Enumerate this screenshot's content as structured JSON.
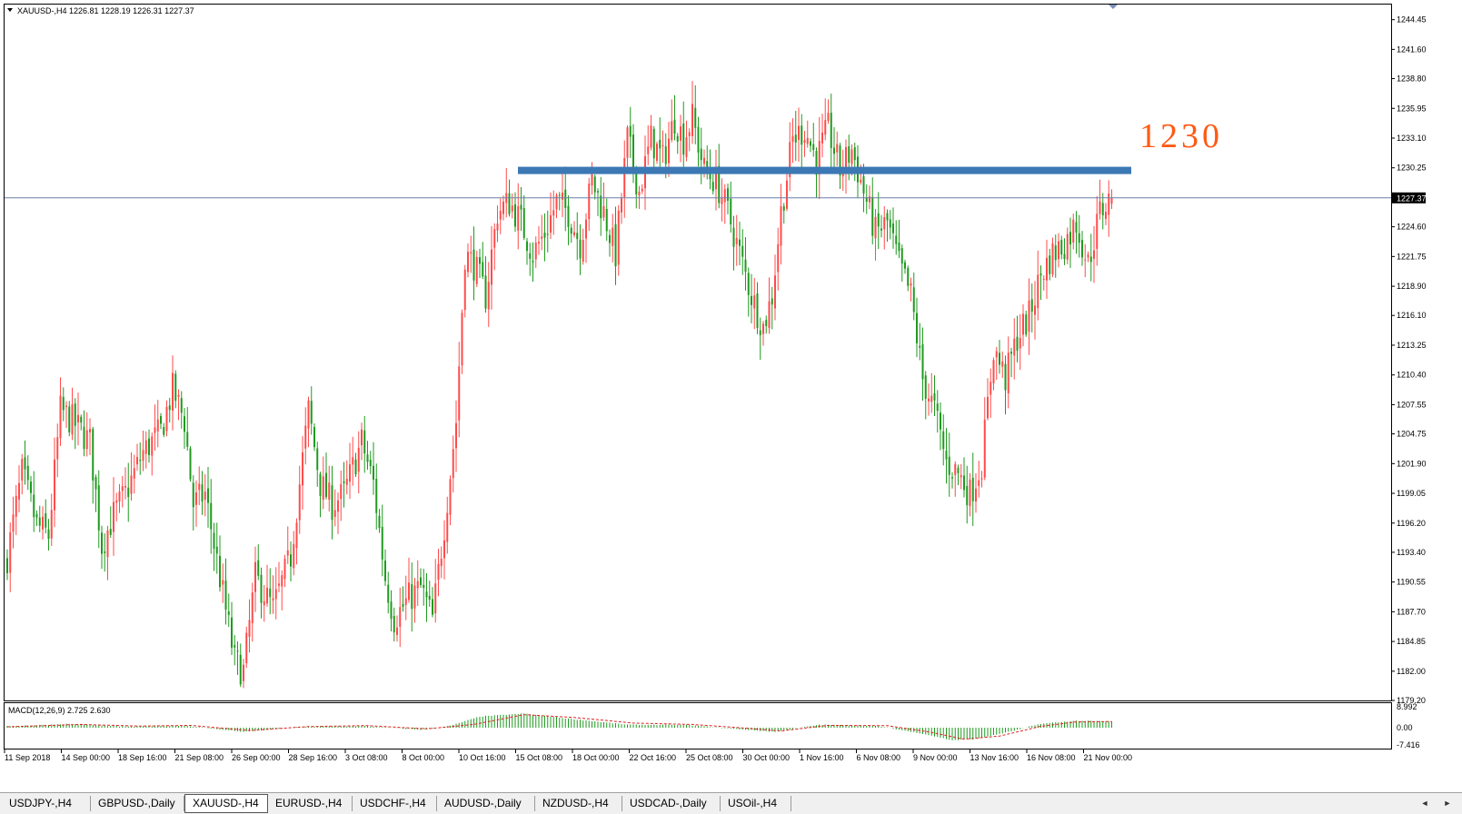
{
  "header": {
    "symbol_line": "XAUUSD-,H4  1226.81 1228.19 1226.31 1227.37"
  },
  "annotation": {
    "level_text": "1230"
  },
  "price_axis": {
    "labels": [
      "1244.45",
      "1241.60",
      "1238.80",
      "1235.95",
      "1233.10",
      "1230.25",
      "1224.60",
      "1221.75",
      "1218.90",
      "1216.10",
      "1213.25",
      "1210.40",
      "1207.55",
      "1204.75",
      "1201.90",
      "1199.05",
      "1196.20",
      "1193.40",
      "1190.55",
      "1187.70",
      "1184.85",
      "1182.00",
      "1179.20"
    ],
    "current_price": "1227.37"
  },
  "macd": {
    "title": "MACD(12,26,9) 2.725 2.630",
    "axis_labels": [
      "8.992",
      "0.00",
      "-7.416"
    ]
  },
  "time_axis": {
    "labels": [
      "11 Sep 2018",
      "14 Sep 00:00",
      "18 Sep 16:00",
      "21 Sep 08:00",
      "26 Sep 00:00",
      "28 Sep 16:00",
      "3 Oct 08:00",
      "8 Oct 00:00",
      "10 Oct 16:00",
      "15 Oct 08:00",
      "18 Oct 00:00",
      "22 Oct 16:00",
      "25 Oct 08:00",
      "30 Oct 00:00",
      "1 Nov 16:00",
      "6 Nov 08:00",
      "9 Nov 00:00",
      "13 Nov 16:00",
      "16 Nov 08:00",
      "21 Nov 00:00"
    ]
  },
  "tabs": [
    {
      "label": "USDJPY-,H4",
      "active": false
    },
    {
      "label": "GBPUSD-,Daily",
      "active": false
    },
    {
      "label": "XAUUSD-,H4",
      "active": true
    },
    {
      "label": "EURUSD-,H4",
      "active": false
    },
    {
      "label": "USDCHF-,H4",
      "active": false
    },
    {
      "label": "AUDUSD-,Daily",
      "active": false
    },
    {
      "label": "NZDUSD-,H4",
      "active": false
    },
    {
      "label": "USDCAD-,Daily",
      "active": false
    },
    {
      "label": "USOil-,H4",
      "active": false
    }
  ],
  "colors": {
    "bull": "#ff4b4b",
    "bear": "#1f9a1f",
    "resistance": "#3c78b4",
    "current_line": "#6a7fa8",
    "level_text": "#ff5a14"
  },
  "chart_data": {
    "type": "candlestick",
    "symbol": "XAUUSD-,H4",
    "ylim": [
      1179.2,
      1245.9
    ],
    "resistance_level": 1230.0,
    "current_price": 1227.37,
    "last_candle": {
      "open": 1226.81,
      "high": 1228.19,
      "low": 1226.31,
      "close": 1227.37
    },
    "path_close": [
      [
        0,
        1193
      ],
      [
        5,
        1201
      ],
      [
        10,
        1196
      ],
      [
        14,
        1195
      ],
      [
        18,
        1207
      ],
      [
        22,
        1206
      ],
      [
        28,
        1204
      ],
      [
        32,
        1194
      ],
      [
        36,
        1197
      ],
      [
        40,
        1199
      ],
      [
        46,
        1203
      ],
      [
        52,
        1205
      ],
      [
        56,
        1209
      ],
      [
        60,
        1206
      ],
      [
        63,
        1198
      ],
      [
        67,
        1199
      ],
      [
        72,
        1191
      ],
      [
        77,
        1183
      ],
      [
        80,
        1182
      ],
      [
        84,
        1191
      ],
      [
        90,
        1188
      ],
      [
        96,
        1193
      ],
      [
        102,
        1207
      ],
      [
        106,
        1200
      ],
      [
        110,
        1198
      ],
      [
        114,
        1199
      ],
      [
        120,
        1204
      ],
      [
        124,
        1200
      ],
      [
        128,
        1191
      ],
      [
        131,
        1187
      ],
      [
        136,
        1189
      ],
      [
        140,
        1190
      ],
      [
        144,
        1187
      ],
      [
        148,
        1196
      ],
      [
        152,
        1206
      ],
      [
        155,
        1222
      ],
      [
        158,
        1221
      ],
      [
        162,
        1218
      ],
      [
        166,
        1226
      ],
      [
        170,
        1227
      ],
      [
        174,
        1225
      ],
      [
        178,
        1222
      ],
      [
        182,
        1224
      ],
      [
        186,
        1227
      ],
      [
        190,
        1226
      ],
      [
        194,
        1223
      ],
      [
        198,
        1229
      ],
      [
        202,
        1226
      ],
      [
        206,
        1222
      ],
      [
        210,
        1233
      ],
      [
        214,
        1228
      ],
      [
        218,
        1233
      ],
      [
        222,
        1231
      ],
      [
        226,
        1235
      ],
      [
        229,
        1233
      ],
      [
        232,
        1235
      ],
      [
        236,
        1230
      ],
      [
        240,
        1229
      ],
      [
        244,
        1226
      ],
      [
        248,
        1222
      ],
      [
        252,
        1218
      ],
      [
        256,
        1215
      ],
      [
        259,
        1218
      ],
      [
        262,
        1226
      ],
      [
        266,
        1233
      ],
      [
        270,
        1234
      ],
      [
        274,
        1231
      ],
      [
        278,
        1234
      ],
      [
        282,
        1230
      ],
      [
        286,
        1232
      ],
      [
        290,
        1228
      ],
      [
        294,
        1224
      ],
      [
        298,
        1225
      ],
      [
        302,
        1221
      ],
      [
        306,
        1218
      ],
      [
        310,
        1210
      ],
      [
        314,
        1207
      ],
      [
        318,
        1202
      ],
      [
        322,
        1201
      ],
      [
        326,
        1199
      ],
      [
        330,
        1202
      ],
      [
        334,
        1213
      ],
      [
        338,
        1210
      ],
      [
        342,
        1214
      ],
      [
        346,
        1216
      ],
      [
        350,
        1220
      ],
      [
        354,
        1222
      ],
      [
        358,
        1223
      ],
      [
        362,
        1225
      ],
      [
        366,
        1221
      ],
      [
        370,
        1226
      ],
      [
        374,
        1227.4
      ]
    ],
    "macd_histogram_path": [
      [
        0,
        0.6
      ],
      [
        20,
        1.6
      ],
      [
        40,
        0.5
      ],
      [
        60,
        0.9
      ],
      [
        80,
        -1.8
      ],
      [
        100,
        0.4
      ],
      [
        120,
        0.8
      ],
      [
        140,
        -0.9
      ],
      [
        150,
        0.8
      ],
      [
        160,
        4.8
      ],
      [
        175,
        6.1
      ],
      [
        190,
        3.9
      ],
      [
        210,
        1.3
      ],
      [
        230,
        1.2
      ],
      [
        245,
        -0.4
      ],
      [
        260,
        -1.8
      ],
      [
        275,
        1.3
      ],
      [
        295,
        0.7
      ],
      [
        310,
        -2.6
      ],
      [
        320,
        -5.4
      ],
      [
        328,
        -4.9
      ],
      [
        340,
        -1.6
      ],
      [
        350,
        1.7
      ],
      [
        362,
        3.0
      ],
      [
        374,
        2.7
      ]
    ],
    "macd_signal_path": [
      [
        0,
        0.4
      ],
      [
        25,
        1.4
      ],
      [
        45,
        0.7
      ],
      [
        62,
        1.0
      ],
      [
        82,
        -1.2
      ],
      [
        102,
        0.5
      ],
      [
        122,
        0.9
      ],
      [
        142,
        -0.5
      ],
      [
        158,
        1.4
      ],
      [
        175,
        5.6
      ],
      [
        192,
        4.4
      ],
      [
        212,
        2.0
      ],
      [
        232,
        1.4
      ],
      [
        248,
        0.0
      ],
      [
        262,
        -1.4
      ],
      [
        278,
        1.0
      ],
      [
        298,
        0.9
      ],
      [
        312,
        -1.8
      ],
      [
        324,
        -4.9
      ],
      [
        336,
        -3.6
      ],
      [
        350,
        0.6
      ],
      [
        362,
        2.5
      ],
      [
        374,
        2.63
      ]
    ]
  }
}
